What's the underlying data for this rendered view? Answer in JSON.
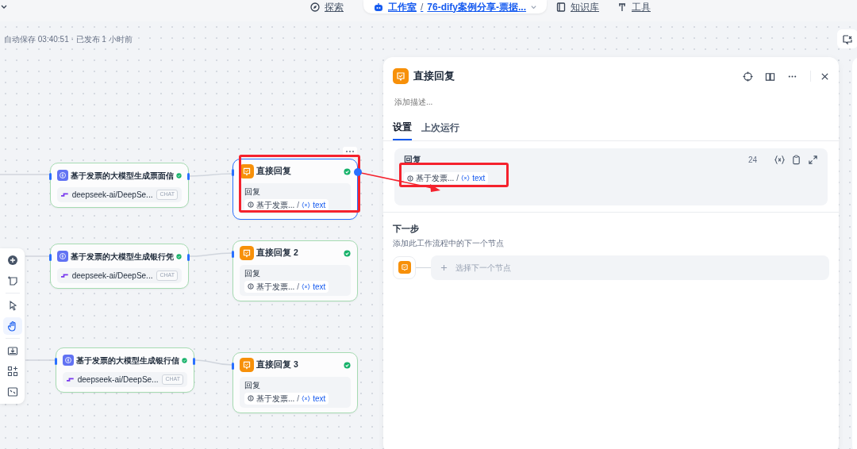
{
  "top_nav": [
    {
      "kind": "explore",
      "label": "探索",
      "selected": false
    },
    {
      "kind": "studio",
      "label": "工作室",
      "separator": "/",
      "current": "76-dify案例分享-票据...",
      "selected": true
    },
    {
      "kind": "knowledge",
      "label": "知识库",
      "selected": false
    },
    {
      "kind": "tools",
      "label": "工具",
      "selected": false
    }
  ],
  "save_status": "自动保存 03:40:51 · 已发布 1 小时前",
  "llm_nodes": [
    {
      "title": "基于发票的大模型生成票面信",
      "model": "deepseek-ai/DeepSe...",
      "mode": "CHAT"
    },
    {
      "title": "基于发票的大模型生成银行凭",
      "model": "deepseek-ai/DeepSe...",
      "mode": "CHAT"
    },
    {
      "title": "基于发票的大模型生成银行信",
      "model": "deepseek-ai/DeepSe...",
      "mode": "CHAT"
    }
  ],
  "reply_nodes": [
    {
      "title": "直接回复",
      "selected": true,
      "field_label": "回复",
      "source": "基于发票...",
      "separator": "/",
      "variable": "text"
    },
    {
      "title": "直接回复 2",
      "selected": false,
      "field_label": "回复",
      "source": "基于发票...",
      "separator": "/",
      "variable": "text"
    },
    {
      "title": "直接回复 3",
      "selected": false,
      "field_label": "回复",
      "source": "基于发票...",
      "separator": "/",
      "variable": "text"
    }
  ],
  "tools": [
    {
      "kind": "add",
      "selected": false
    },
    {
      "kind": "note",
      "selected": false
    },
    {
      "kind": "divider"
    },
    {
      "kind": "pointer",
      "selected": false
    },
    {
      "kind": "hand",
      "selected": true
    },
    {
      "kind": "divider"
    },
    {
      "kind": "export",
      "selected": false
    },
    {
      "kind": "organize",
      "selected": false
    },
    {
      "kind": "fit",
      "selected": false
    }
  ],
  "panel": {
    "title": "直接回复",
    "description_placeholder": "添加描述...",
    "tabs": [
      {
        "label": "设置",
        "selected": true
      },
      {
        "label": "上次运行",
        "selected": false
      }
    ],
    "reply": {
      "label": "回复",
      "count": "24",
      "source": "基于发票...",
      "separator": "/",
      "variable": "text"
    },
    "next_step": {
      "title": "下一步",
      "hint": "添加此工作流程中的下一个节点",
      "select_label": "选择下一个节点"
    }
  }
}
